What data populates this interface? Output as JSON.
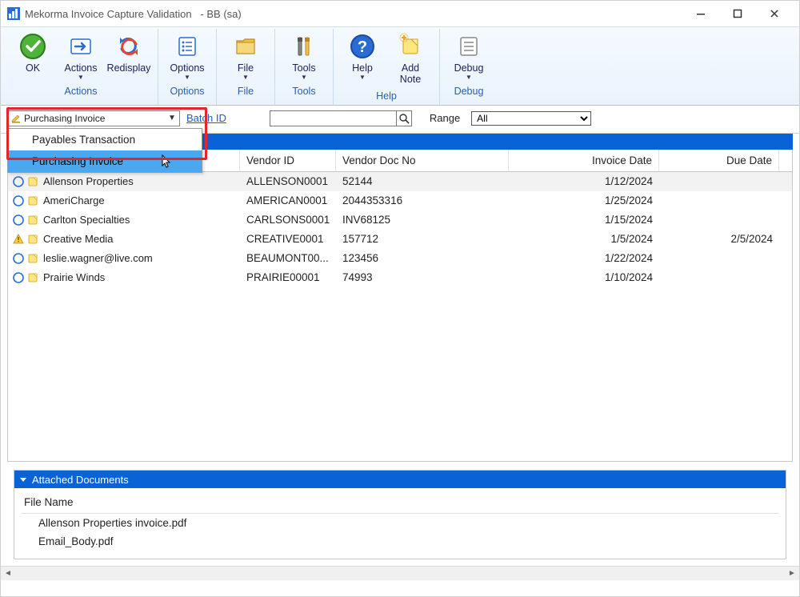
{
  "titlebar": {
    "app_title": "Mekorma Invoice Capture Validation",
    "context": "-  BB (sa)"
  },
  "ribbon": {
    "groups": [
      {
        "label": "Actions",
        "items": [
          {
            "key": "ok",
            "label": "OK"
          },
          {
            "key": "actions",
            "label": "Actions",
            "dropdown": true
          },
          {
            "key": "redisplay",
            "label": "Redisplay"
          }
        ]
      },
      {
        "label": "Options",
        "items": [
          {
            "key": "options",
            "label": "Options",
            "dropdown": true
          }
        ]
      },
      {
        "label": "File",
        "items": [
          {
            "key": "file",
            "label": "File",
            "dropdown": true
          }
        ]
      },
      {
        "label": "Tools",
        "items": [
          {
            "key": "tools",
            "label": "Tools",
            "dropdown": true
          }
        ]
      },
      {
        "label": "Help",
        "items": [
          {
            "key": "help",
            "label": "Help",
            "dropdown": true
          },
          {
            "key": "addnote",
            "label": "Add Note"
          }
        ]
      },
      {
        "label": "Debug",
        "items": [
          {
            "key": "debug",
            "label": "Debug",
            "dropdown": true
          }
        ]
      }
    ]
  },
  "filter": {
    "type_selected": "Purchasing Invoice",
    "type_options": [
      "Payables Transaction",
      "Purchasing Invoice"
    ],
    "batch_link": "Batch ID",
    "range_label": "Range",
    "range_selected": "All"
  },
  "grid": {
    "columns": [
      "Vendor ID",
      "Vendor Doc No",
      "Invoice Date",
      "Due Date"
    ],
    "rows": [
      {
        "status": "ok",
        "vendor_name": "Allenson Properties",
        "vendor_id": "ALLENSON0001",
        "doc_no": "52144",
        "invoice_date": "1/12/2024",
        "due_date": ""
      },
      {
        "status": "ok",
        "vendor_name": "AmeriCharge",
        "vendor_id": "AMERICAN0001",
        "doc_no": "2044353316",
        "invoice_date": "1/25/2024",
        "due_date": ""
      },
      {
        "status": "ok",
        "vendor_name": "Carlton Specialties",
        "vendor_id": "CARLSONS0001",
        "doc_no": "INV68125",
        "invoice_date": "1/15/2024",
        "due_date": ""
      },
      {
        "status": "warn",
        "vendor_name": "Creative Media",
        "vendor_id": "CREATIVE0001",
        "doc_no": "157712",
        "invoice_date": "1/5/2024",
        "due_date": "2/5/2024"
      },
      {
        "status": "ok",
        "vendor_name": "leslie.wagner@live.com",
        "vendor_id": "BEAUMONT00...",
        "doc_no": "123456",
        "invoice_date": "1/22/2024",
        "due_date": ""
      },
      {
        "status": "ok",
        "vendor_name": "Prairie Winds",
        "vendor_id": "PRAIRIE00001",
        "doc_no": "74993",
        "invoice_date": "1/10/2024",
        "due_date": ""
      }
    ]
  },
  "attached": {
    "panel_title": "Attached Documents",
    "column": "File Name",
    "files": [
      "Allenson Properties invoice.pdf",
      "Email_Body.pdf"
    ]
  }
}
